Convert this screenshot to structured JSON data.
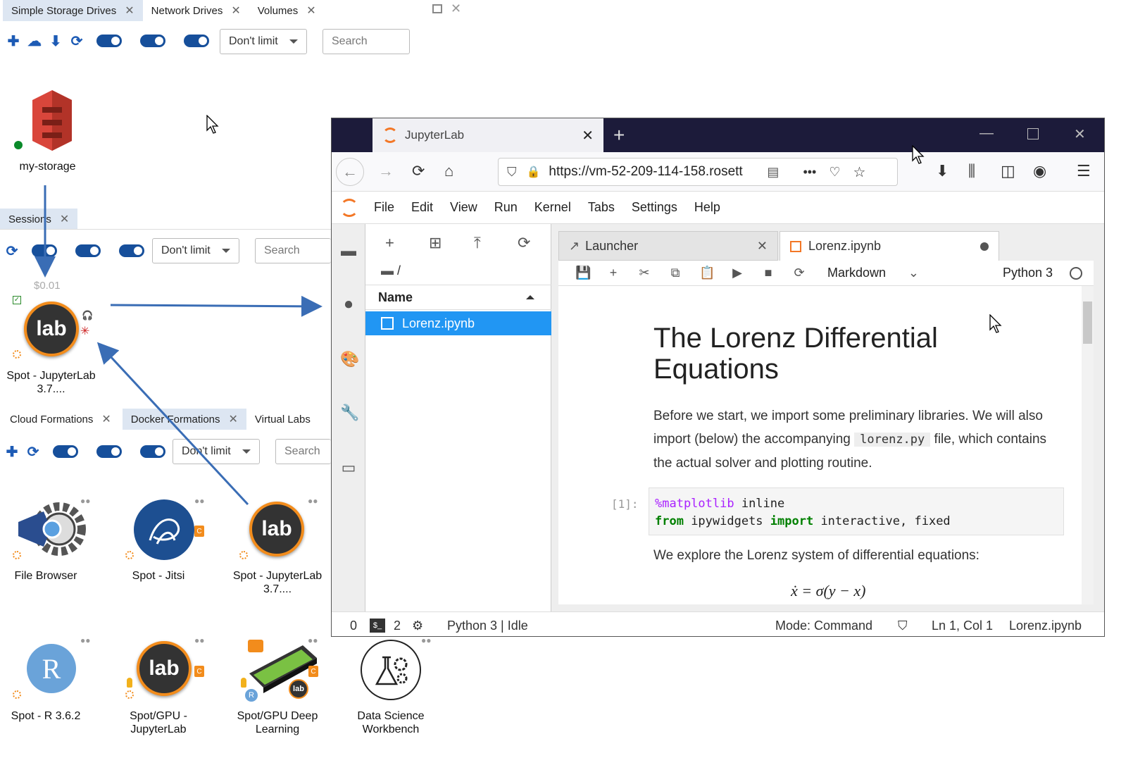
{
  "top_panel": {
    "tabs": [
      {
        "label": "Simple Storage Drives",
        "active": true
      },
      {
        "label": "Network Drives",
        "active": false
      },
      {
        "label": "Volumes",
        "active": false
      }
    ],
    "limit_select": "Don't limit",
    "search_placeholder": "Search",
    "storage_tile": {
      "label": "my-storage",
      "status_color": "#0a8a2a"
    }
  },
  "sessions_panel": {
    "tabs": [
      {
        "label": "Sessions",
        "active": true
      }
    ],
    "limit_select": "Don't limit",
    "search_placeholder": "Search",
    "session": {
      "cost": "$0.01",
      "icon_text": "lab",
      "label_line1": "Spot - JupyterLab",
      "label_line2": "3.7...."
    }
  },
  "formations_panel": {
    "tabs": [
      {
        "label": "Cloud Formations",
        "active": false
      },
      {
        "label": "Docker Formations",
        "active": true
      },
      {
        "label": "Virtual Labs",
        "active": false
      }
    ],
    "limit_select": "Don't limit",
    "search_placeholder": "Search",
    "tiles": [
      {
        "line1": "File Browser",
        "line2": ""
      },
      {
        "line1": "Spot - Jitsi",
        "line2": ""
      },
      {
        "line1": "Spot - JupyterLab",
        "line2": "3.7...."
      },
      {
        "line1": "Spot - R 3.6.2",
        "line2": ""
      },
      {
        "line1": "Spot/GPU -",
        "line2": "JupyterLab"
      },
      {
        "line1": "Spot/GPU Deep",
        "line2": "Learning"
      },
      {
        "line1": "Data Science",
        "line2": "Workbench"
      }
    ],
    "icon_texts": {
      "lab": "lab",
      "r": "R",
      "c": "C"
    }
  },
  "browser": {
    "tab_title": "JupyterLab",
    "url": "https://vm-52-209-114-158.rosett",
    "menu": [
      "File",
      "Edit",
      "View",
      "Run",
      "Kernel",
      "Tabs",
      "Settings",
      "Help"
    ],
    "file_browser": {
      "path": "/",
      "column_header": "Name",
      "files": [
        {
          "name": "Lorenz.ipynb",
          "selected": true
        }
      ]
    },
    "doc_tabs": [
      {
        "label": "Launcher",
        "active": false
      },
      {
        "label": "Lorenz.ipynb",
        "active": true
      }
    ],
    "cell_type": "Markdown",
    "kernel_name": "Python 3",
    "notebook": {
      "title": "The Lorenz Differential Equations",
      "para1_a": "Before we start, we import some preliminary libraries. We will also import (below) the accompanying",
      "para1_code": "lorenz.py",
      "para1_b": "file, which contains the actual solver and plotting routine.",
      "prompt": "[1]:",
      "code_line1_magic": "%matplotlib",
      "code_line1_rest": " inline",
      "code_line2_from": "from",
      "code_line2_mid": " ipywidgets ",
      "code_line2_import": "import",
      "code_line2_rest": " interactive, fixed",
      "para2": "We explore the Lorenz system of differential equations:",
      "equation": "ẋ = σ(y − x)"
    },
    "status": {
      "terminals": "0",
      "kernels": "2",
      "kernel_state": "Python 3 | Idle",
      "mode": "Mode: Command",
      "position": "Ln 1, Col 1",
      "file": "Lorenz.ipynb"
    }
  }
}
